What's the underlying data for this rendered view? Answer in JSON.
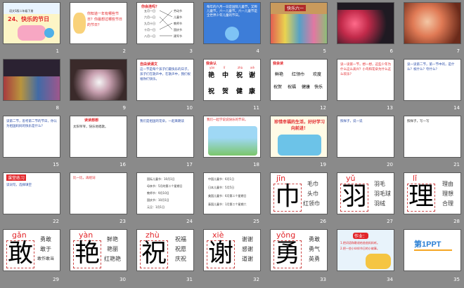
{
  "slides": [
    {
      "n": "1",
      "title": "24、快乐的节日",
      "sub": "语文S版二年级下册"
    },
    {
      "n": "2",
      "text": "你知道一年有哪些节日？你最想过哪些节日的节日？"
    },
    {
      "n": "3",
      "title": "你会连吗？",
      "left": [
        "五月一日",
        "六月一日",
        "九月十日",
        "十月一日",
        "八月一日"
      ],
      "right": [
        "劳动节",
        "儿童节",
        "教师节",
        "国庆节",
        "建军节"
      ]
    },
    {
      "n": "4",
      "text": "每年的六月一日是国际儿童节，又称儿童节，六一儿童节。六一儿童节是全世界少年儿童的节日。"
    },
    {
      "n": "5",
      "banner": "快乐六一"
    },
    {
      "n": "6"
    },
    {
      "n": "7"
    },
    {
      "n": "8"
    },
    {
      "n": "9"
    },
    {
      "n": "10",
      "title": "自由读课文",
      "text": "这一节是每个孩子们最快乐的日子，孩子们在歌声中，在歌声中，我们祝福你们快乐。"
    },
    {
      "n": "11",
      "title": "我会认",
      "pinyin": [
        "yàn",
        "lǐ",
        "zhù",
        "xiè",
        "jiān"
      ],
      "chars": [
        "艳",
        "中",
        "祝",
        "谢",
        "巾"
      ],
      "chars2": [
        "祝",
        "贺",
        "健",
        "康"
      ]
    },
    {
      "n": "12",
      "title": "我会读",
      "line1": [
        "鲜艳",
        "红领巾",
        "欢度"
      ],
      "line2": [
        "祝贺",
        "祝福",
        "健康",
        "快乐"
      ]
    },
    {
      "n": "13",
      "text": "读一读第一节，想一想，这些少年为什么这么高兴？小鸟和花朵为什么这么欢乐？"
    },
    {
      "n": "14",
      "text": "读一读第二节，第一节中的，是什么？祝什么？夸什么？"
    },
    {
      "n": "15",
      "text": "读第二节，思考第二节的节日，你认为祖国妈妈的快乐是什么？"
    },
    {
      "n": "16",
      "title": "读读想想",
      "text": "太阳爷爷，快乐地唱歌。"
    },
    {
      "n": "17",
      "text": "我们是祖国的花朵。一起来朗读"
    },
    {
      "n": "18",
      "text": "我们一起学说说快乐的节日。"
    },
    {
      "n": "19",
      "text": "珍惜幸福的生活，好好学习向前进！"
    },
    {
      "n": "20",
      "text": "照样子，说一说"
    },
    {
      "n": "21",
      "text": "照样子，写一写"
    },
    {
      "n": "22",
      "title": "课堂练习",
      "text": "读词句，选择填空"
    },
    {
      "n": "23",
      "text": "比一比，再组词"
    },
    {
      "n": "24",
      "rows": [
        "国际儿童节：10月1日",
        "母亲节：5月的第二个星期日",
        "教师节：9月10日",
        "国庆节：10月1日",
        "元旦：1月1日"
      ]
    },
    {
      "n": "25",
      "rows": [
        "中国儿童节：6月1日",
        "日本儿童节：5月5日",
        "美国儿童节：6月第二个星期日",
        "泰国儿童节：1月第二个星期六"
      ]
    },
    {
      "n": "26",
      "py": "jīn",
      "char": "巾",
      "words": [
        "毛巾",
        "头巾",
        "红领巾"
      ]
    },
    {
      "n": "27",
      "py": "yǔ",
      "char": "羽",
      "words": [
        "羽毛",
        "羽毛球",
        "羽绒"
      ]
    },
    {
      "n": "28",
      "py": "lǐ",
      "char": "理",
      "words": [
        "理由",
        "理想",
        "合理"
      ]
    },
    {
      "n": "29",
      "py": "gǎn",
      "char": "敢",
      "words": [
        "勇敢",
        "敢于",
        "敢作敢当"
      ]
    },
    {
      "n": "30",
      "py": "yàn",
      "char": "艳",
      "words": [
        "鲜艳",
        "艳丽",
        "红艳艳"
      ]
    },
    {
      "n": "31",
      "py": "zhù",
      "char": "祝",
      "words": [
        "祝福",
        "祝愿",
        "庆祝"
      ]
    },
    {
      "n": "32",
      "py": "xiè",
      "char": "谢",
      "words": [
        "谢谢",
        "感谢",
        "道谢"
      ]
    },
    {
      "n": "33",
      "py": "yǒng",
      "char": "勇",
      "words": [
        "勇敢",
        "勇气",
        "英勇"
      ]
    },
    {
      "n": "34",
      "title": "作业：",
      "items": [
        "1.把词语和歌谣给爸爸妈妈听。",
        "2.把一些小伙伴节日的小故事。"
      ]
    },
    {
      "n": "35",
      "logo": "第1PPT"
    }
  ],
  "colors": {
    "accent": "#e2262a",
    "sky": "#3d7dd8",
    "cover_bg": "#f3e68a",
    "dark_stage": "#2b2232"
  }
}
